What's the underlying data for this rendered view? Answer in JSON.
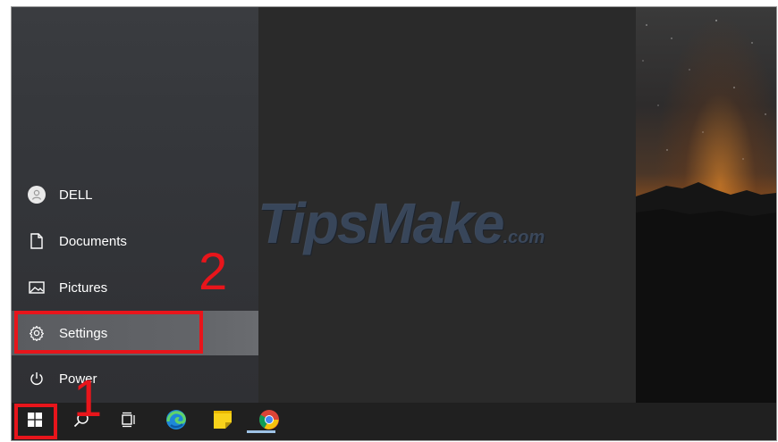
{
  "start_menu": {
    "items": [
      {
        "label": "DELL",
        "icon": "user-avatar-icon"
      },
      {
        "label": "Documents",
        "icon": "document-icon"
      },
      {
        "label": "Pictures",
        "icon": "pictures-icon"
      },
      {
        "label": "Settings",
        "icon": "gear-icon"
      },
      {
        "label": "Power",
        "icon": "power-icon"
      }
    ]
  },
  "taskbar": {
    "icons": [
      "windows-start-icon",
      "search-icon",
      "task-view-icon",
      "edge-icon",
      "sticky-notes-icon",
      "chrome-icon"
    ]
  },
  "annotations": {
    "step1": "1",
    "step2": "2",
    "color": "#e8151b"
  },
  "watermark": {
    "text": "TipsMake",
    "suffix": ".com"
  },
  "colors": {
    "taskbar": "#202020",
    "menu_bg": "#34363a",
    "settings_highlight": "#5a5c60"
  }
}
